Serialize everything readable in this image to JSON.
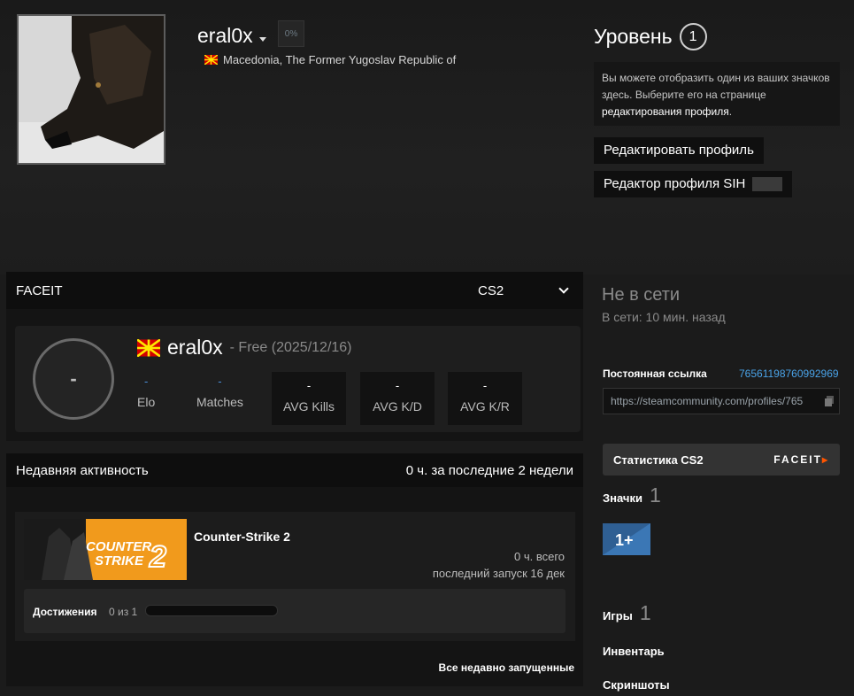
{
  "profile": {
    "name": "eral0x",
    "xp_percent": "0%",
    "location": "Macedonia, The Former Yugoslav Republic of"
  },
  "level": {
    "label": "Уровень",
    "value": "1"
  },
  "badge_hint": {
    "text": "Вы можете отобразить один из ваших значков здесь. Выберите его на странице ",
    "link": "редактирования профиля",
    "end": "."
  },
  "buttons": {
    "edit_profile": "Редактировать профиль",
    "sih_editor": "Редактор профиля SIH"
  },
  "faceit": {
    "title": "FACEIT",
    "game": "CS2",
    "level": "-",
    "player_name": "eral0x",
    "subscription": "- Free (2025/12/16)",
    "stats": [
      {
        "label": "Elo",
        "value": "-"
      },
      {
        "label": "Matches",
        "value": "-"
      },
      {
        "label": "AVG Kills",
        "value": "-"
      },
      {
        "label": "AVG K/D",
        "value": "-"
      },
      {
        "label": "AVG K/R",
        "value": "-"
      }
    ]
  },
  "activity": {
    "title": "Недавняя активность",
    "hours": "0 ч. за последние 2 недели",
    "game": {
      "name": "Counter-Strike 2",
      "capsule_text": [
        "COUNTER",
        "STRIKE"
      ],
      "capsule_num": "2",
      "total": "0 ч. всего",
      "last_played": "последний запуск 16 дек",
      "achievements_label": "Достижения",
      "achievements_count": "0 из 1",
      "achievements_progress": 0
    },
    "all_recent": "Все недавно запущенные"
  },
  "sidebar": {
    "status": "Не в сети",
    "last_online": "В сети: 10 мин. назад",
    "permalink_label": "Постоянная ссылка",
    "steam_id": "76561198760992969",
    "permalink_url": "https://steamcommunity.com/profiles/765",
    "stats_button": "Статистика CS2",
    "stats_logo": "FACEIT",
    "badges_label": "Значки",
    "badges_count": "1",
    "badge_years": "1+",
    "games_label": "Игры",
    "games_count": "1",
    "inventory": "Инвентарь",
    "screenshots": "Скриншоты"
  },
  "colors": {
    "accent_blue": "#4aa3e8",
    "faceit_orange": "#ff5500",
    "cs2_orange": "#f19a1c"
  }
}
